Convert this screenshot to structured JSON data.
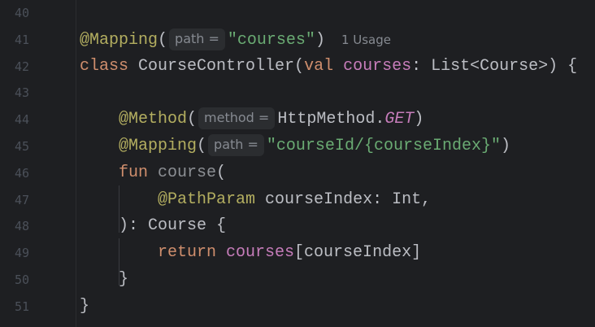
{
  "editor": {
    "line_numbers": [
      "40",
      "41",
      "42",
      "43",
      "44",
      "45",
      "46",
      "47",
      "48",
      "49",
      "50",
      "51"
    ],
    "lines": [
      {
        "tokens": []
      },
      {
        "tokens": [
          {
            "t": "@Mapping",
            "c": "annotation"
          },
          {
            "t": "("
          },
          {
            "t": "path =",
            "c": "hint"
          },
          {
            "t": "\"courses\"",
            "c": "string"
          },
          {
            "t": ")"
          },
          {
            "t": "1 Usage",
            "c": "usage"
          }
        ]
      },
      {
        "tokens": [
          {
            "t": "class ",
            "c": "keyword"
          },
          {
            "t": "CourseController("
          },
          {
            "t": "val ",
            "c": "keyword"
          },
          {
            "t": "courses",
            "c": "property"
          },
          {
            "t": ": List<Course>) {"
          }
        ]
      },
      {
        "tokens": []
      },
      {
        "tokens": [
          {
            "t": "    "
          },
          {
            "t": "@Method",
            "c": "annotation"
          },
          {
            "t": "("
          },
          {
            "t": "method =",
            "c": "hint"
          },
          {
            "t": "HttpMethod."
          },
          {
            "t": "GET",
            "c": "enum"
          },
          {
            "t": ")"
          }
        ]
      },
      {
        "tokens": [
          {
            "t": "    "
          },
          {
            "t": "@Mapping",
            "c": "annotation"
          },
          {
            "t": "("
          },
          {
            "t": "path =",
            "c": "hint"
          },
          {
            "t": "\"courseId/{courseIndex}\"",
            "c": "string"
          },
          {
            "t": ")"
          }
        ]
      },
      {
        "tokens": [
          {
            "t": "    "
          },
          {
            "t": "fun ",
            "c": "keyword"
          },
          {
            "t": "course",
            "c": "unused"
          },
          {
            "t": "("
          }
        ]
      },
      {
        "tokens": [
          {
            "t": "        "
          },
          {
            "t": "@PathParam",
            "c": "annotation"
          },
          {
            "t": " courseIndex: Int,"
          }
        ]
      },
      {
        "tokens": [
          {
            "t": "    "
          },
          {
            "t": "): Course {"
          }
        ]
      },
      {
        "tokens": [
          {
            "t": "        "
          },
          {
            "t": "return ",
            "c": "keyword"
          },
          {
            "t": "courses",
            "c": "property"
          },
          {
            "t": "[courseIndex]"
          }
        ]
      },
      {
        "tokens": [
          {
            "t": "    "
          },
          {
            "t": "}"
          }
        ]
      },
      {
        "tokens": [
          {
            "t": "}"
          }
        ]
      }
    ]
  },
  "colors": {
    "background": "#1e1f22",
    "annotation": "#b3ae60",
    "keyword": "#cf8e6d",
    "string": "#6aab73",
    "property": "#c77dbb",
    "text": "#bcbec4"
  }
}
